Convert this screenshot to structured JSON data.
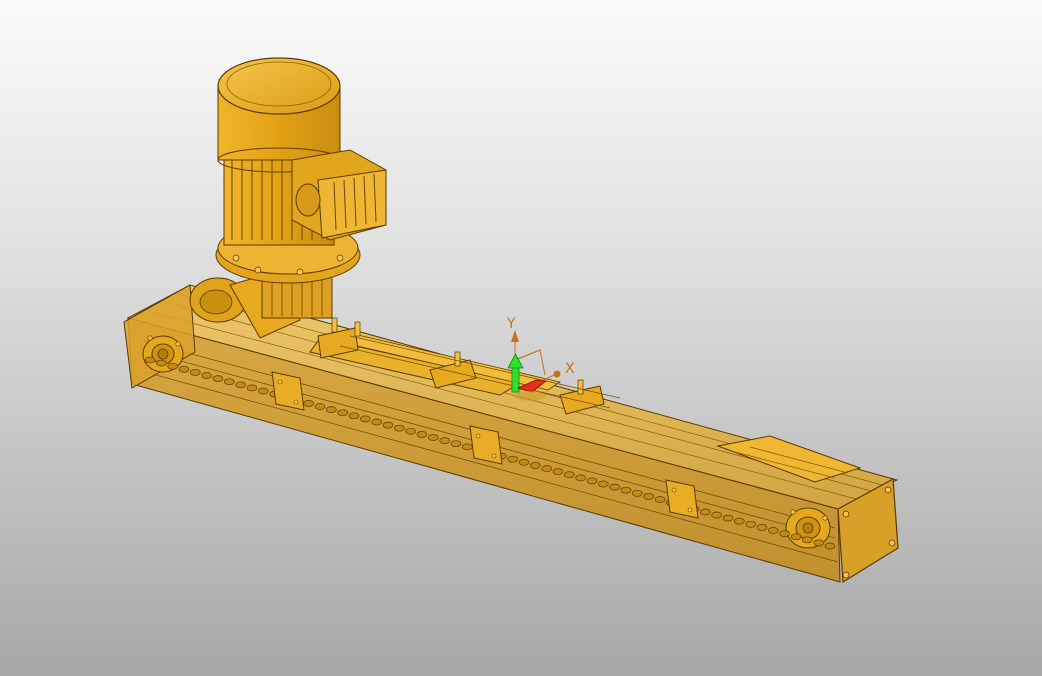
{
  "viewport": {
    "background_top": "#fbfbfb",
    "background_bottom": "#a7a7a7",
    "model_color": "#e0a418",
    "model_edge_color": "#5a3b00"
  },
  "triad": {
    "x_label": "X",
    "y_label": "Y",
    "x_color": "#e2301c",
    "y_color": "#2ee02e",
    "label_color": "#c9721a"
  }
}
